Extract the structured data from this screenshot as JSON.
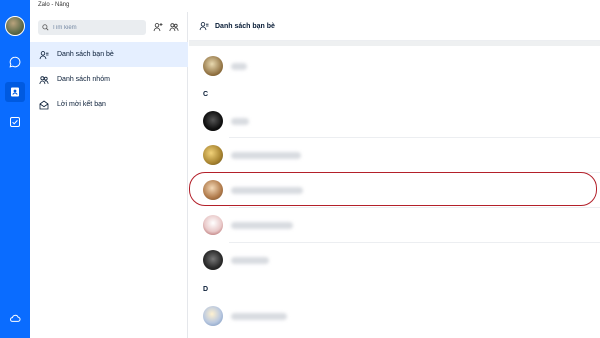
{
  "window": {
    "title": "Zalo - Nâng"
  },
  "rail": {
    "icons": [
      "chat-icon",
      "contacts-icon",
      "todo-icon",
      "cloud-icon"
    ],
    "accent": "#0a6cff"
  },
  "sidebar": {
    "search_placeholder": "Tìm kiếm",
    "add_friend_icon": "add-friend-icon",
    "create_group_icon": "create-group-icon",
    "items": [
      {
        "label": "Danh sách bạn bè",
        "icon": "friends-list-icon",
        "active": true
      },
      {
        "label": "Danh sách nhóm",
        "icon": "group-list-icon",
        "active": false
      },
      {
        "label": "Lời mời kết bạn",
        "icon": "friend-request-icon",
        "active": false
      }
    ]
  },
  "main": {
    "header_title": "Danh sách bạn bè",
    "sections": [
      "C",
      "D"
    ]
  },
  "colors": {
    "highlight": "#b3202a",
    "active_bg": "#e5efff"
  }
}
